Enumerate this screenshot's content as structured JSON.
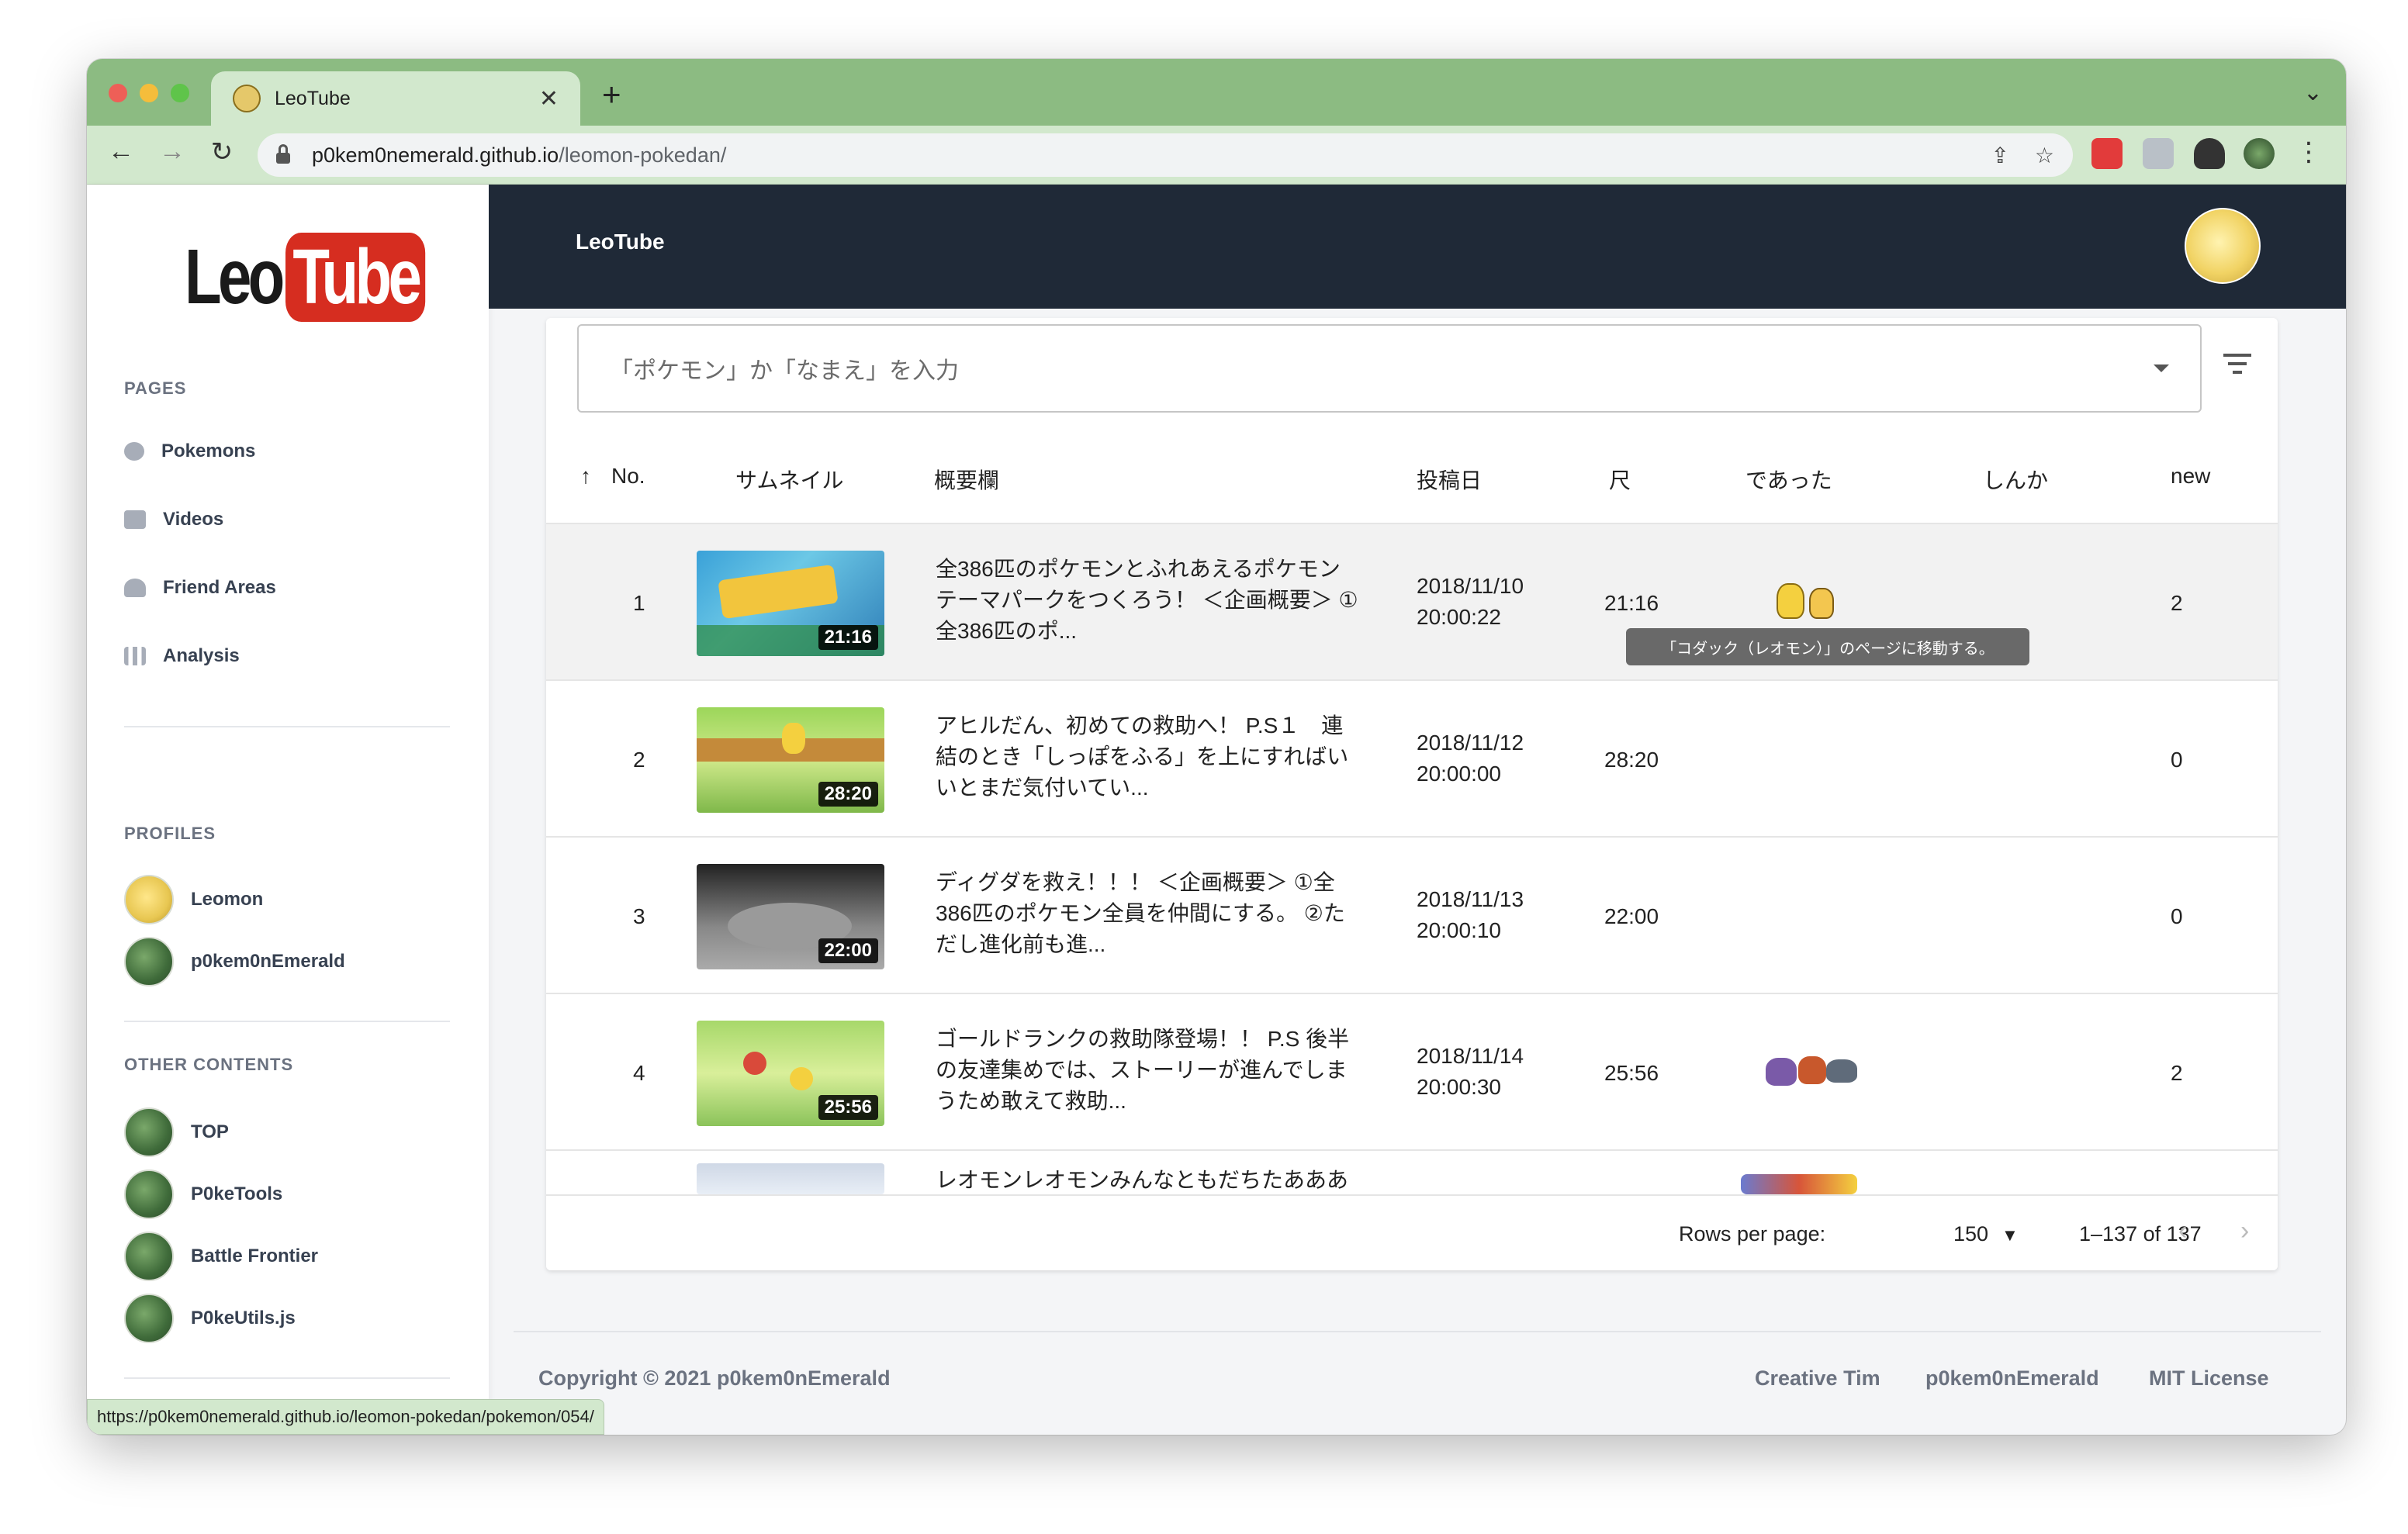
{
  "browser": {
    "tab_title": "LeoTube",
    "url_host": "p0kem0nemerald.github.io",
    "url_path": "/leomon-pokedan/",
    "status_url": "https://p0kem0nemerald.github.io/leomon-pokedan/pokemon/054/"
  },
  "logo": {
    "part1": "Leo",
    "part2": "Tube"
  },
  "sidebar": {
    "pages_title": "PAGES",
    "pages": [
      {
        "label": "Pokemons",
        "icon": "paw-icon"
      },
      {
        "label": "Videos",
        "icon": "video-icon"
      },
      {
        "label": "Friend Areas",
        "icon": "people-icon"
      },
      {
        "label": "Analysis",
        "icon": "chart-icon"
      }
    ],
    "profiles_title": "PROFILES",
    "profiles": [
      "Leomon",
      "p0kem0nEmerald"
    ],
    "other_title": "OTHER CONTENTS",
    "others": [
      "TOP",
      "P0keTools",
      "Battle Frontier",
      "P0keUtils.js"
    ]
  },
  "header": {
    "title": "LeoTube"
  },
  "search": {
    "placeholder": "「ポケモン」か「なまえ」を入力"
  },
  "table": {
    "columns": [
      "No.",
      "サムネイル",
      "概要欄",
      "投稿日",
      "尺",
      "であった",
      "しんか",
      "new"
    ],
    "rows": [
      {
        "no": "1",
        "desc": [
          "全386匹のポケモンとふれあえるポケモン",
          "テーマパークをつくろう！ ＜企画概要＞ ①",
          "全386匹のポ..."
        ],
        "date": "2018/11/10",
        "time": "20:00:22",
        "length": "21:16",
        "badge": "21:16",
        "new": "2"
      },
      {
        "no": "2",
        "desc": [
          "アヒルだん、初めての救助へ！ P.S１　連",
          "結のとき「しっぽをふる」を上にすればい",
          "いとまだ気付いてい..."
        ],
        "date": "2018/11/12",
        "time": "20:00:00",
        "length": "28:20",
        "badge": "28:20",
        "new": "0"
      },
      {
        "no": "3",
        "desc": [
          "ディグダを救え！！！ ＜企画概要＞ ①全",
          "386匹のポケモン全員を仲間にする。 ②た",
          "だし進化前も進..."
        ],
        "date": "2018/11/13",
        "time": "20:00:10",
        "length": "22:00",
        "badge": "22:00",
        "new": "0"
      },
      {
        "no": "4",
        "desc": [
          "ゴールドランクの救助隊登場！！ P.S 後半",
          "の友達集めでは、ストーリーが進んでしま",
          "うため敢えて救助..."
        ],
        "date": "2018/11/14",
        "time": "20:00:30",
        "length": "25:56",
        "badge": "25:56",
        "new": "2"
      },
      {
        "desc": [
          "レオモンレオモンみんなともだちたあああ"
        ]
      }
    ],
    "tooltip": "「コダック（レオモン）」のページに移動する。"
  },
  "pagination": {
    "rows_per_page_label": "Rows per page:",
    "rows_per_page_value": "150",
    "range": "1–137 of 137"
  },
  "footer": {
    "copyright": "Copyright © 2021 p0kem0nEmerald",
    "links": [
      "Creative Tim",
      "p0kem0nEmerald",
      "MIT License"
    ]
  }
}
